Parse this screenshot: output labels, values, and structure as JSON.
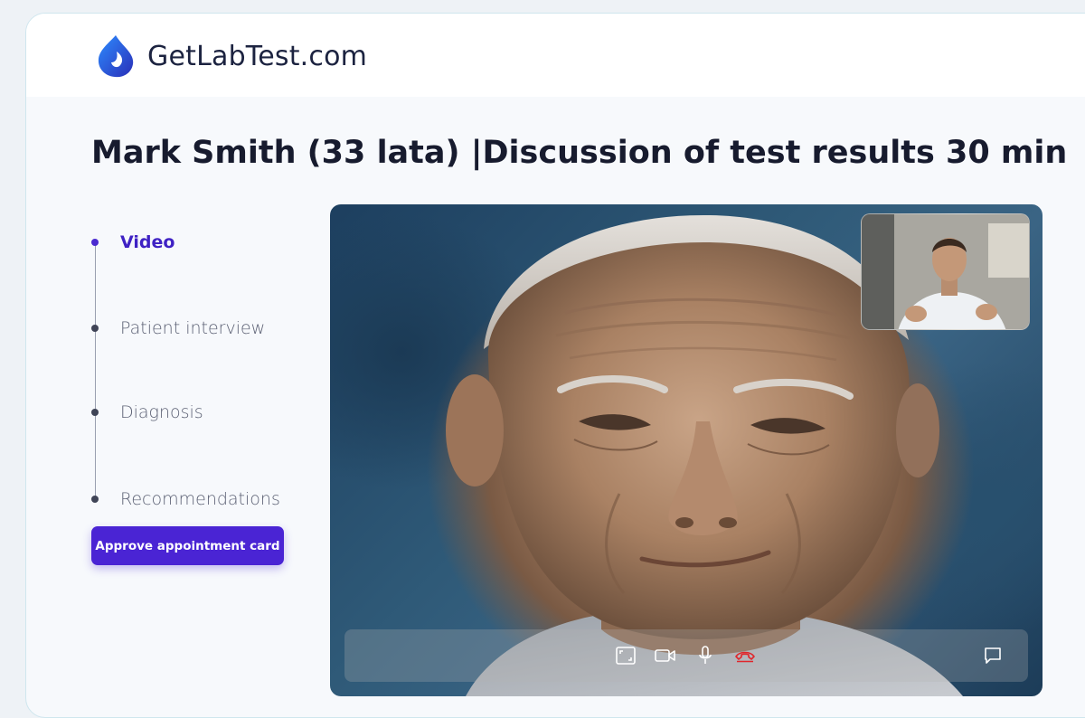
{
  "brand": {
    "name": "GetLabTest.com"
  },
  "page": {
    "title": "Mark Smith (33 lata) |Discussion of test results 30 min"
  },
  "steps": [
    {
      "label": "Video",
      "active": true
    },
    {
      "label": "Patient interview",
      "active": false
    },
    {
      "label": "Diagnosis",
      "active": false
    },
    {
      "label": "Recommendations",
      "active": false
    }
  ],
  "actions": {
    "approve_label": "Approve appointment card"
  },
  "video": {
    "controls": [
      "fullscreen-icon",
      "camera-icon",
      "microphone-icon",
      "end-call-icon",
      "chat-icon"
    ]
  },
  "colors": {
    "accent": "#4a24d4",
    "active_step": "#3f22c4",
    "end_call": "#e0262b",
    "title": "#171b2e"
  }
}
